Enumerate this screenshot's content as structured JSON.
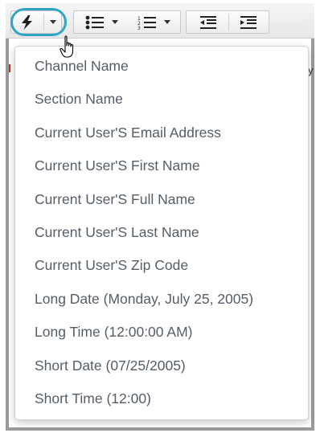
{
  "toolbar": {
    "buttons": [
      {
        "icon": "lightning-bolt-icon",
        "has_caret": true
      },
      {
        "icon": "bullet-list-icon",
        "has_caret": true
      },
      {
        "icon": "numbered-list-icon",
        "has_caret": true
      },
      {
        "icon": "outdent-icon",
        "has_caret": false
      },
      {
        "icon": "indent-icon",
        "has_caret": false
      }
    ],
    "highlight_color": "#31a6c4"
  },
  "background_text": {
    "right_char": "y"
  },
  "dropdown": {
    "items": [
      {
        "label": "Channel Name"
      },
      {
        "label": "Section Name"
      },
      {
        "label": "Current User'S Email Address"
      },
      {
        "label": "Current User'S First Name"
      },
      {
        "label": "Current User'S Full Name"
      },
      {
        "label": "Current User'S Last Name"
      },
      {
        "label": "Current User'S Zip Code"
      },
      {
        "label": "Long Date (Monday, July 25, 2005)"
      },
      {
        "label": "Long Time (12:00:00 AM)"
      },
      {
        "label": "Short Date (07/25/2005)"
      },
      {
        "label": "Short Time (12:00)"
      }
    ],
    "text_color": "#555d66"
  }
}
